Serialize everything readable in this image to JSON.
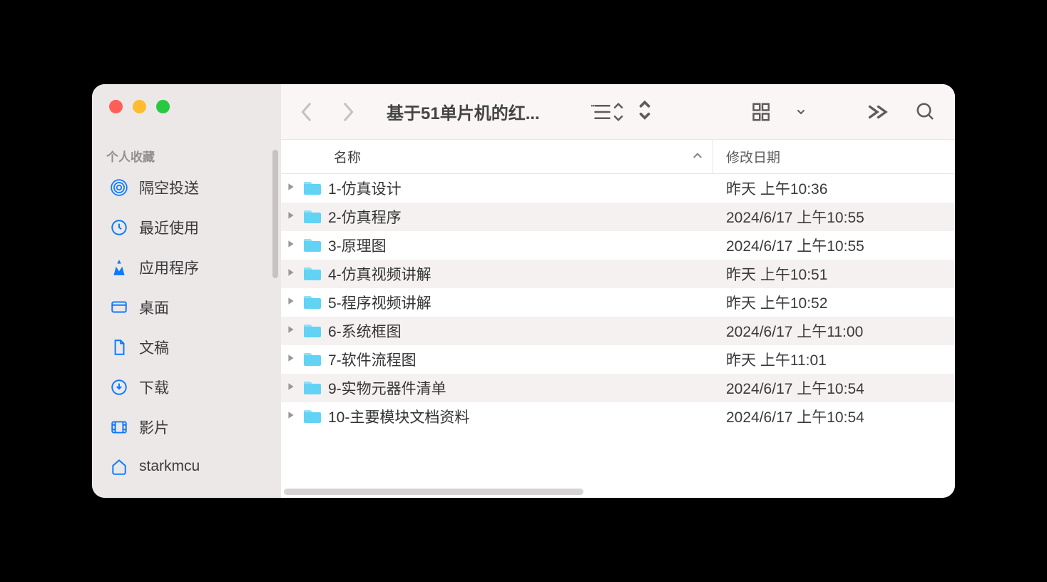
{
  "sidebar": {
    "section_label": "个人收藏",
    "items": [
      {
        "label": "隔空投送"
      },
      {
        "label": "最近使用"
      },
      {
        "label": "应用程序"
      },
      {
        "label": "桌面"
      },
      {
        "label": "文稿"
      },
      {
        "label": "下载"
      },
      {
        "label": "影片"
      },
      {
        "label": "starkmcu"
      }
    ]
  },
  "toolbar": {
    "title": "基于51单片机的红..."
  },
  "columns": {
    "name": "名称",
    "date": "修改日期"
  },
  "files": [
    {
      "name": "1-仿真设计",
      "date": "昨天 上午10:36"
    },
    {
      "name": "2-仿真程序",
      "date": "2024/6/17 上午10:55"
    },
    {
      "name": "3-原理图",
      "date": "2024/6/17 上午10:55"
    },
    {
      "name": "4-仿真视频讲解",
      "date": "昨天 上午10:51"
    },
    {
      "name": "5-程序视频讲解",
      "date": "昨天 上午10:52"
    },
    {
      "name": "6-系统框图",
      "date": "2024/6/17 上午11:00"
    },
    {
      "name": "7-软件流程图",
      "date": "昨天 上午11:01"
    },
    {
      "name": "9-实物元器件清单",
      "date": "2024/6/17 上午10:54"
    },
    {
      "name": "10-主要模块文档资料",
      "date": "2024/6/17 上午10:54"
    }
  ]
}
